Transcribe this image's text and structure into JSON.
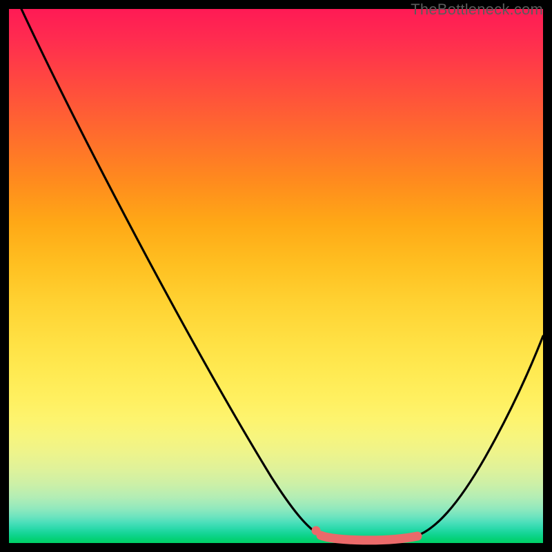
{
  "watermark": "TheBottleneck.com",
  "chart_data": {
    "type": "line",
    "title": "",
    "xlabel": "",
    "ylabel": "",
    "xlim": [
      0,
      100
    ],
    "ylim": [
      0,
      100
    ],
    "grid": false,
    "series": [
      {
        "name": "bottleneck-curve",
        "color": "#000000",
        "x": [
          0,
          5,
          10,
          15,
          20,
          25,
          30,
          35,
          40,
          45,
          50,
          55,
          57,
          60,
          63,
          66,
          70,
          74,
          78,
          82,
          86,
          90,
          94,
          98,
          100
        ],
        "y": [
          99,
          92,
          85,
          78,
          70,
          62,
          54,
          46,
          38,
          30,
          22,
          14,
          10,
          5,
          2.5,
          1.2,
          0.5,
          0.5,
          1.2,
          3,
          7,
          14,
          24,
          36,
          43
        ]
      },
      {
        "name": "optimal-range",
        "color": "#ea6a6a",
        "x": [
          57,
          60,
          63,
          66,
          70,
          74,
          78
        ],
        "y": [
          1.8,
          0.9,
          0.6,
          0.5,
          0.5,
          0.6,
          1.3
        ]
      }
    ],
    "optimal_range": {
      "start_pct": 57,
      "end_pct": 78
    }
  },
  "colors": {
    "curve": "#000000",
    "highlight": "#ea6a6a",
    "frame": "#000000"
  }
}
